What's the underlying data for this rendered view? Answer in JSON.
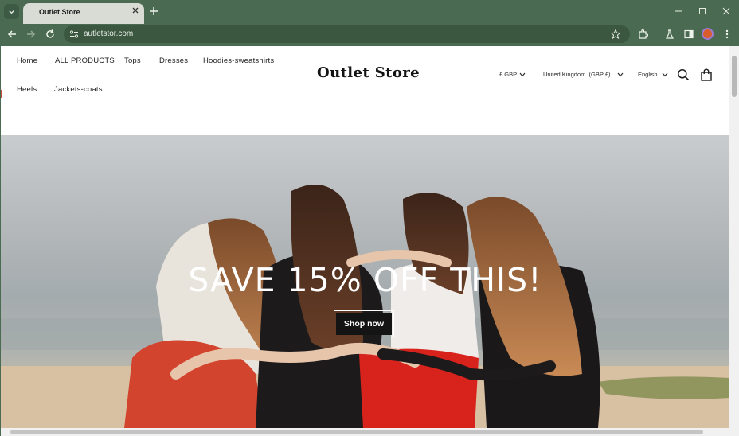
{
  "browser": {
    "tab_title": "Outlet Store",
    "url": "autletstor.com"
  },
  "store": {
    "logo": "Outlet Store",
    "nav": [
      "Home",
      "ALL PRODUCTS",
      "Tops",
      "Dresses",
      "Hoodies-sweatshirts",
      "Heels",
      "Jackets-coats"
    ],
    "currency": "£ GBP",
    "country": "United Kingdom  (GBP £)",
    "language": "English"
  },
  "hero": {
    "heading": "SAVE 15% OFF THIS!",
    "button": "Shop now"
  },
  "icons": {
    "search": "search-icon",
    "cart": "shopping-bag-icon",
    "bookmark": "star-icon",
    "extensions": "puzzle-icon",
    "labs": "flask-icon",
    "sidebar": "side-panel-icon",
    "menu": "kebab-menu-icon"
  },
  "colors": {
    "chrome": "#4a6b52",
    "button": "#141414",
    "page": "#ffffff"
  }
}
